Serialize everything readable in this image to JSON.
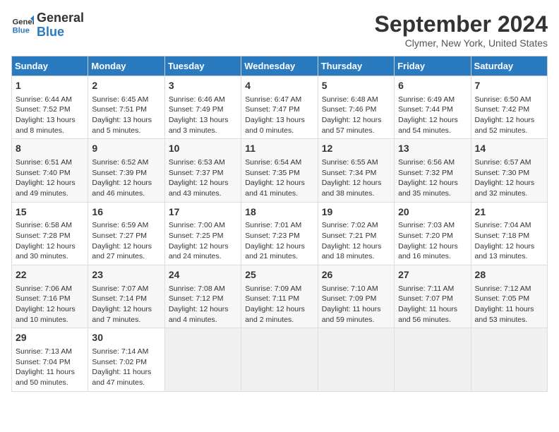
{
  "header": {
    "logo_line1": "General",
    "logo_line2": "Blue",
    "month_year": "September 2024",
    "location": "Clymer, New York, United States"
  },
  "weekdays": [
    "Sunday",
    "Monday",
    "Tuesday",
    "Wednesday",
    "Thursday",
    "Friday",
    "Saturday"
  ],
  "weeks": [
    [
      {
        "day": "1",
        "info": "Sunrise: 6:44 AM\nSunset: 7:52 PM\nDaylight: 13 hours\nand 8 minutes."
      },
      {
        "day": "2",
        "info": "Sunrise: 6:45 AM\nSunset: 7:51 PM\nDaylight: 13 hours\nand 5 minutes."
      },
      {
        "day": "3",
        "info": "Sunrise: 6:46 AM\nSunset: 7:49 PM\nDaylight: 13 hours\nand 3 minutes."
      },
      {
        "day": "4",
        "info": "Sunrise: 6:47 AM\nSunset: 7:47 PM\nDaylight: 13 hours\nand 0 minutes."
      },
      {
        "day": "5",
        "info": "Sunrise: 6:48 AM\nSunset: 7:46 PM\nDaylight: 12 hours\nand 57 minutes."
      },
      {
        "day": "6",
        "info": "Sunrise: 6:49 AM\nSunset: 7:44 PM\nDaylight: 12 hours\nand 54 minutes."
      },
      {
        "day": "7",
        "info": "Sunrise: 6:50 AM\nSunset: 7:42 PM\nDaylight: 12 hours\nand 52 minutes."
      }
    ],
    [
      {
        "day": "8",
        "info": "Sunrise: 6:51 AM\nSunset: 7:40 PM\nDaylight: 12 hours\nand 49 minutes."
      },
      {
        "day": "9",
        "info": "Sunrise: 6:52 AM\nSunset: 7:39 PM\nDaylight: 12 hours\nand 46 minutes."
      },
      {
        "day": "10",
        "info": "Sunrise: 6:53 AM\nSunset: 7:37 PM\nDaylight: 12 hours\nand 43 minutes."
      },
      {
        "day": "11",
        "info": "Sunrise: 6:54 AM\nSunset: 7:35 PM\nDaylight: 12 hours\nand 41 minutes."
      },
      {
        "day": "12",
        "info": "Sunrise: 6:55 AM\nSunset: 7:34 PM\nDaylight: 12 hours\nand 38 minutes."
      },
      {
        "day": "13",
        "info": "Sunrise: 6:56 AM\nSunset: 7:32 PM\nDaylight: 12 hours\nand 35 minutes."
      },
      {
        "day": "14",
        "info": "Sunrise: 6:57 AM\nSunset: 7:30 PM\nDaylight: 12 hours\nand 32 minutes."
      }
    ],
    [
      {
        "day": "15",
        "info": "Sunrise: 6:58 AM\nSunset: 7:28 PM\nDaylight: 12 hours\nand 30 minutes."
      },
      {
        "day": "16",
        "info": "Sunrise: 6:59 AM\nSunset: 7:27 PM\nDaylight: 12 hours\nand 27 minutes."
      },
      {
        "day": "17",
        "info": "Sunrise: 7:00 AM\nSunset: 7:25 PM\nDaylight: 12 hours\nand 24 minutes."
      },
      {
        "day": "18",
        "info": "Sunrise: 7:01 AM\nSunset: 7:23 PM\nDaylight: 12 hours\nand 21 minutes."
      },
      {
        "day": "19",
        "info": "Sunrise: 7:02 AM\nSunset: 7:21 PM\nDaylight: 12 hours\nand 18 minutes."
      },
      {
        "day": "20",
        "info": "Sunrise: 7:03 AM\nSunset: 7:20 PM\nDaylight: 12 hours\nand 16 minutes."
      },
      {
        "day": "21",
        "info": "Sunrise: 7:04 AM\nSunset: 7:18 PM\nDaylight: 12 hours\nand 13 minutes."
      }
    ],
    [
      {
        "day": "22",
        "info": "Sunrise: 7:06 AM\nSunset: 7:16 PM\nDaylight: 12 hours\nand 10 minutes."
      },
      {
        "day": "23",
        "info": "Sunrise: 7:07 AM\nSunset: 7:14 PM\nDaylight: 12 hours\nand 7 minutes."
      },
      {
        "day": "24",
        "info": "Sunrise: 7:08 AM\nSunset: 7:12 PM\nDaylight: 12 hours\nand 4 minutes."
      },
      {
        "day": "25",
        "info": "Sunrise: 7:09 AM\nSunset: 7:11 PM\nDaylight: 12 hours\nand 2 minutes."
      },
      {
        "day": "26",
        "info": "Sunrise: 7:10 AM\nSunset: 7:09 PM\nDaylight: 11 hours\nand 59 minutes."
      },
      {
        "day": "27",
        "info": "Sunrise: 7:11 AM\nSunset: 7:07 PM\nDaylight: 11 hours\nand 56 minutes."
      },
      {
        "day": "28",
        "info": "Sunrise: 7:12 AM\nSunset: 7:05 PM\nDaylight: 11 hours\nand 53 minutes."
      }
    ],
    [
      {
        "day": "29",
        "info": "Sunrise: 7:13 AM\nSunset: 7:04 PM\nDaylight: 11 hours\nand 50 minutes."
      },
      {
        "day": "30",
        "info": "Sunrise: 7:14 AM\nSunset: 7:02 PM\nDaylight: 11 hours\nand 47 minutes."
      },
      {
        "day": "",
        "info": ""
      },
      {
        "day": "",
        "info": ""
      },
      {
        "day": "",
        "info": ""
      },
      {
        "day": "",
        "info": ""
      },
      {
        "day": "",
        "info": ""
      }
    ]
  ]
}
